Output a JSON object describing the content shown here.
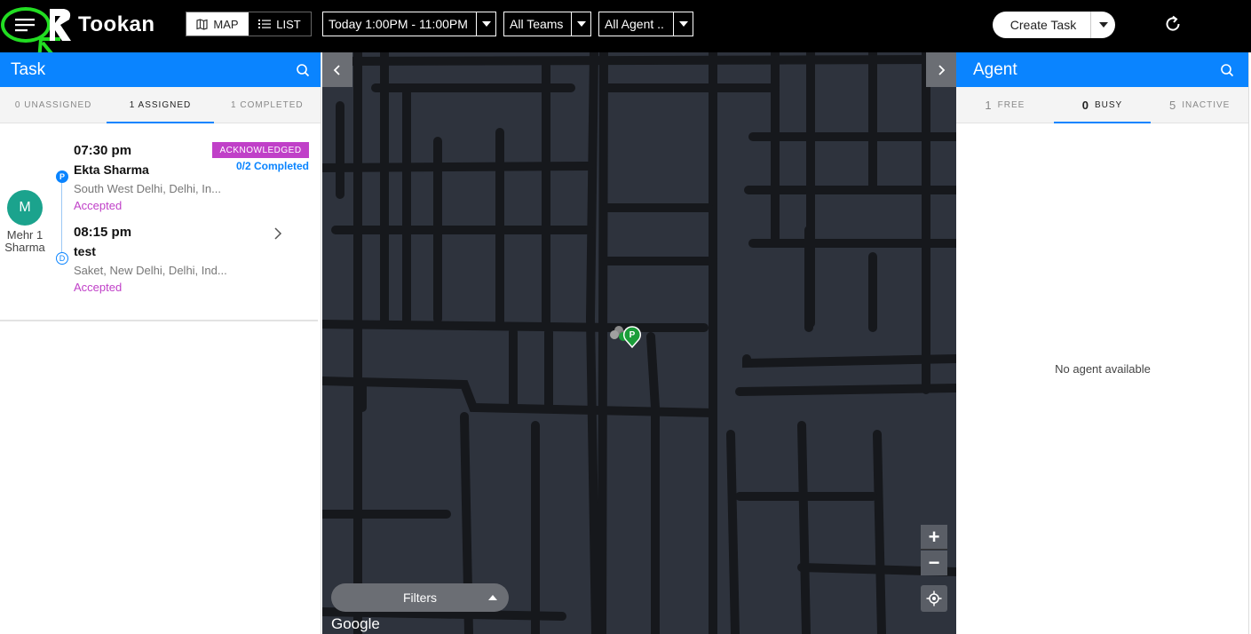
{
  "header": {
    "brand": "Tookan",
    "view_map": "MAP",
    "view_list": "LIST",
    "date_filter": "Today 1:00PM - 11:00PM",
    "team_filter": "All Teams",
    "agent_filter": "All Agent ..",
    "create_task": "Create Task"
  },
  "task_panel": {
    "title": "Task",
    "tabs": [
      {
        "label": "0 UNASSIGNED"
      },
      {
        "label": "1 ASSIGNED"
      },
      {
        "label": "1 COMPLETED"
      }
    ],
    "card": {
      "avatar_initial": "M",
      "agent_name": "Mehr 1 Sharma",
      "badge": "ACKNOWLEDGED",
      "progress": "0/2 Completed",
      "pickup": {
        "marker": "P",
        "time": "07:30 pm",
        "name": "Ekta Sharma",
        "address": "South West Delhi, Delhi, In...",
        "status": "Accepted"
      },
      "delivery": {
        "marker": "D",
        "time": "08:15 pm",
        "name": "test",
        "address": "Saket, New Delhi, Delhi, Ind...",
        "status": "Accepted"
      }
    }
  },
  "map": {
    "filters_label": "Filters",
    "google_label": "Google",
    "zoom_in": "+",
    "zoom_out": "−",
    "pin_label": "P"
  },
  "agent_panel": {
    "title": "Agent",
    "tabs": [
      {
        "count": "1",
        "label": "FREE"
      },
      {
        "count": "0",
        "label": "BUSY"
      },
      {
        "count": "5",
        "label": "INACTIVE"
      }
    ],
    "empty_text": "No agent available"
  },
  "colors": {
    "accent": "#0a84ff",
    "status": "#c040c8",
    "avatar": "#1ba38d",
    "highlight": "#22dd22"
  }
}
